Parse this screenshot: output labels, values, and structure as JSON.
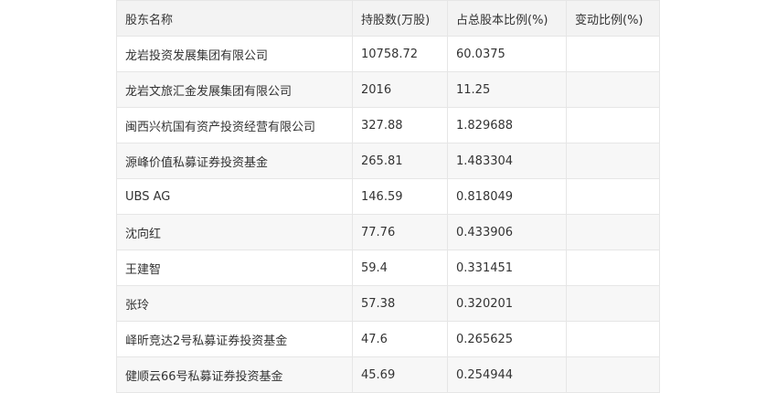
{
  "table": {
    "headers": [
      "股东名称",
      "持股数(万股)",
      "占总股本比例(%)",
      "变动比例(%)"
    ],
    "rows": [
      {
        "name": "龙岩投资发展集团有限公司",
        "shares": "10758.72",
        "ratio": "60.0375",
        "change": ""
      },
      {
        "name": "龙岩文旅汇金发展集团有限公司",
        "shares": "2016",
        "ratio": "11.25",
        "change": ""
      },
      {
        "name": "闽西兴杭国有资产投资经营有限公司",
        "shares": "327.88",
        "ratio": "1.829688",
        "change": ""
      },
      {
        "name": "源峰价值私募证券投资基金",
        "shares": "265.81",
        "ratio": "1.483304",
        "change": ""
      },
      {
        "name": "UBS AG",
        "shares": "146.59",
        "ratio": "0.818049",
        "change": ""
      },
      {
        "name": "沈向红",
        "shares": "77.76",
        "ratio": "0.433906",
        "change": ""
      },
      {
        "name": "王建智",
        "shares": "59.4",
        "ratio": "0.331451",
        "change": ""
      },
      {
        "name": "张玲",
        "shares": "57.38",
        "ratio": "0.320201",
        "change": ""
      },
      {
        "name": "峄昕竞达2号私募证券投资基金",
        "shares": "47.6",
        "ratio": "0.265625",
        "change": ""
      },
      {
        "name": "健顺云66号私募证券投资基金",
        "shares": "45.69",
        "ratio": "0.254944",
        "change": ""
      }
    ]
  }
}
